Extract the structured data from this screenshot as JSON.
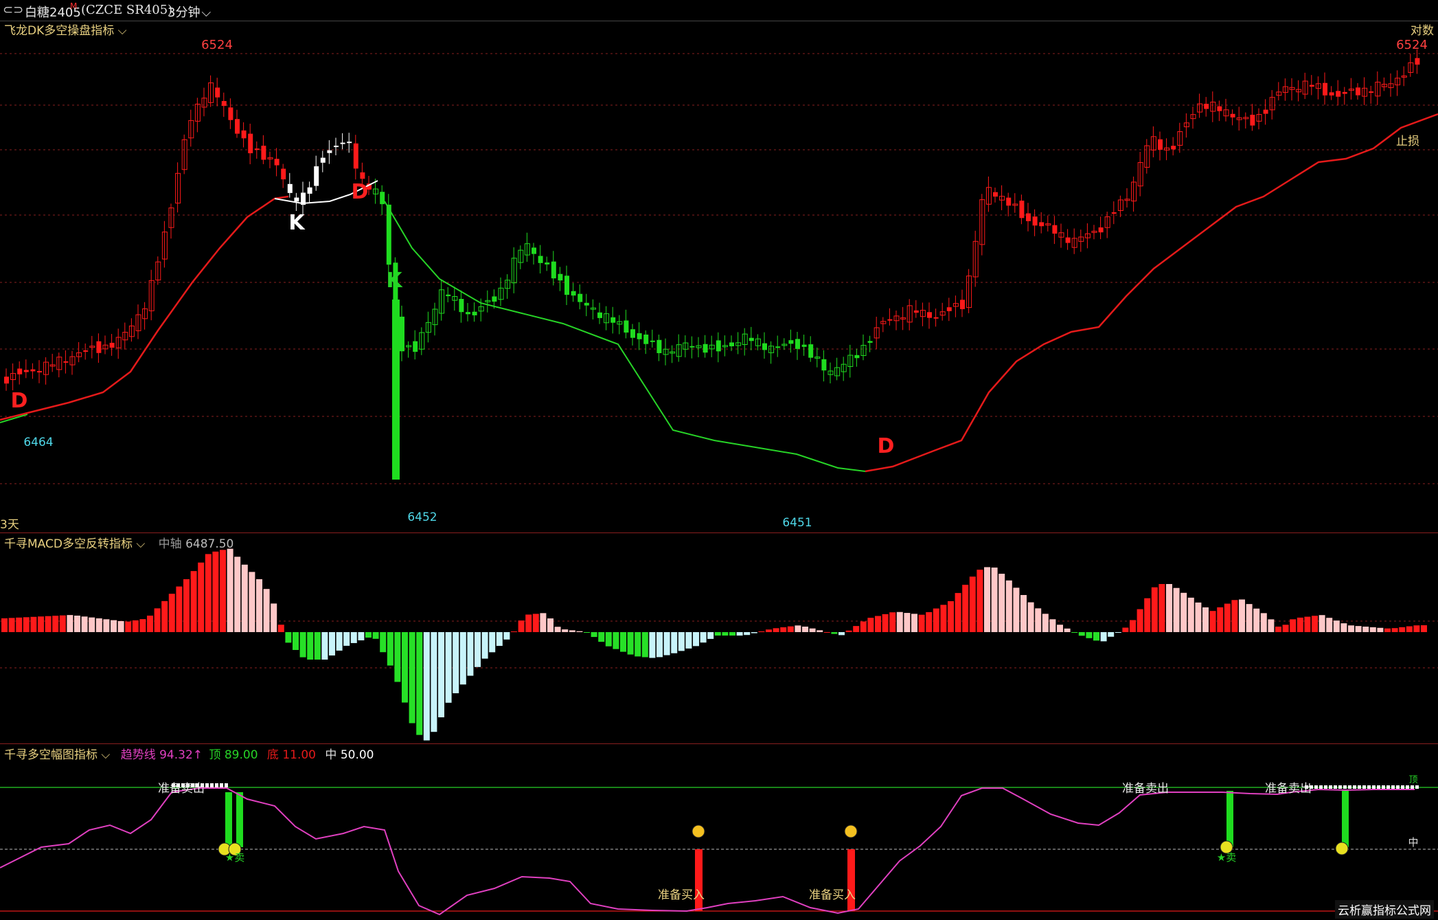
{
  "topbar": {
    "symbol": "白糖2405",
    "sup": "M",
    "code": "(CZCE SR405)",
    "period": "3分钟"
  },
  "main_panel": {
    "indicator_name": "飞龙DK多空操盘指标",
    "right_label": "对数",
    "left_bottom_label": "3天",
    "stop_label": "止损",
    "high_left": "6524",
    "high_right": "6524",
    "low1": "6464",
    "low2": "6452",
    "low3": "6451",
    "signals": [
      "D",
      "K",
      "D",
      "K",
      "D"
    ]
  },
  "macd_panel": {
    "indicator_name": "千寻MACD多空反转指标",
    "axis_label": "中轴",
    "axis_value": "6487.50"
  },
  "amp_panel": {
    "indicator_name": "千寻多空幅图指标",
    "trend_label": "趋势线",
    "trend_value": "94.32↑",
    "top_label": "顶",
    "top_value": "89.00",
    "bottom_label": "底",
    "bottom_value": "11.00",
    "mid_label": "中",
    "mid_value": "50.00",
    "ready_sell": "准备卖出",
    "ready_buy": "准备买入",
    "sell_tag": "★卖",
    "right_mid": "中",
    "right_top": "顶"
  },
  "watermark": "云析赢指标公式网",
  "colors": {
    "up": "#ff1a1a",
    "down": "#1fdc1f",
    "trend_line": "#e040c0",
    "label_yellow": "#e8d080",
    "value_cyan": "#4fd7e8"
  }
}
